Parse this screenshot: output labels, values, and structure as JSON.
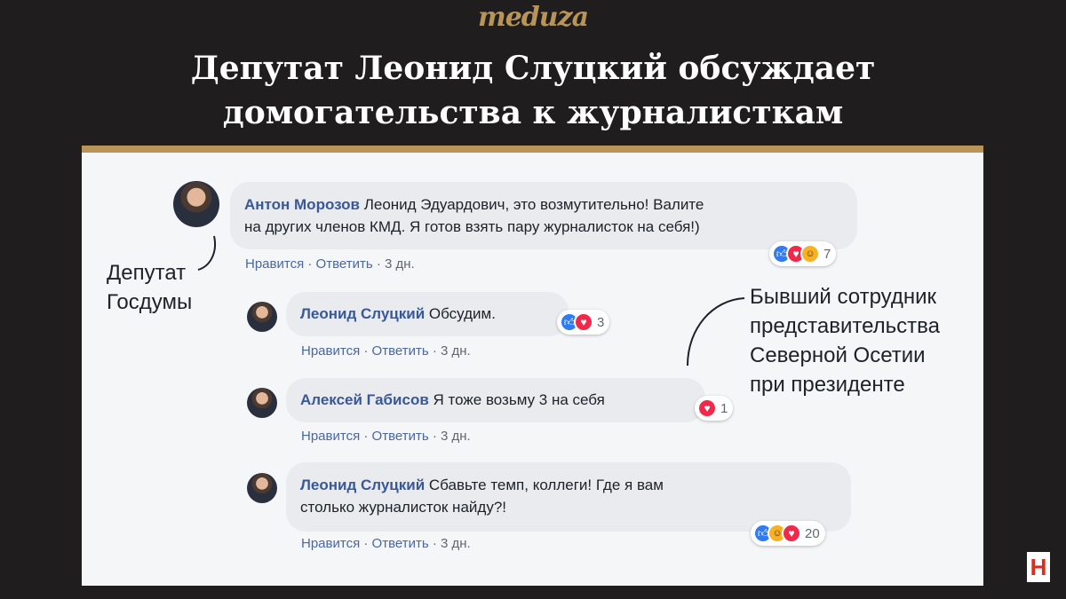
{
  "header": {
    "logo": "meduza",
    "title_line1": "Депутат Леонид Слуцкий обсуждает",
    "title_line2": "домогательства к журналисткам"
  },
  "comments": [
    {
      "author": "Антон Морозов",
      "text_line1": "Леонид Эдуардович, это возмутительно! Валите",
      "text_line2": "на других членов КМД. Я готов взять пару журналисток на себя!)",
      "like_label": "Нравится",
      "reply_label": "Ответить",
      "time": "3 дн.",
      "reactions": [
        "like",
        "love",
        "haha"
      ],
      "reaction_count": "7"
    },
    {
      "author": "Леонид Слуцкий",
      "text": "Обсудим.",
      "like_label": "Нравится",
      "reply_label": "Ответить",
      "time": "3 дн.",
      "reactions": [
        "like",
        "love"
      ],
      "reaction_count": "3"
    },
    {
      "author": "Алексей Габисов",
      "text": "Я тоже возьму 3 на себя",
      "like_label": "Нравится",
      "reply_label": "Ответить",
      "time": "3 дн.",
      "reactions": [
        "love"
      ],
      "reaction_count": "1"
    },
    {
      "author": "Леонид Слуцкий",
      "text_line1": "Сбавьте темп, коллеги! Где я вам",
      "text_line2": "столько журналисток найду?!",
      "like_label": "Нравится",
      "reply_label": "Ответить",
      "time": "3 дн.",
      "reactions": [
        "like",
        "haha",
        "love"
      ],
      "reaction_count": "20"
    }
  ],
  "annotations": {
    "left_line1": "Депутат",
    "left_line2": "Госдумы",
    "right_line1": "Бывший сотрудник",
    "right_line2": "представительства",
    "right_line3": "Северной Осетии",
    "right_line4": "при президенте"
  },
  "colors": {
    "background": "#1f1d1e",
    "accent": "#b89458",
    "link": "#385898",
    "like": "#2f7bf5",
    "love": "#f0284a",
    "haha": "#f7b125"
  },
  "watermark_icon": "h-logo-icon"
}
